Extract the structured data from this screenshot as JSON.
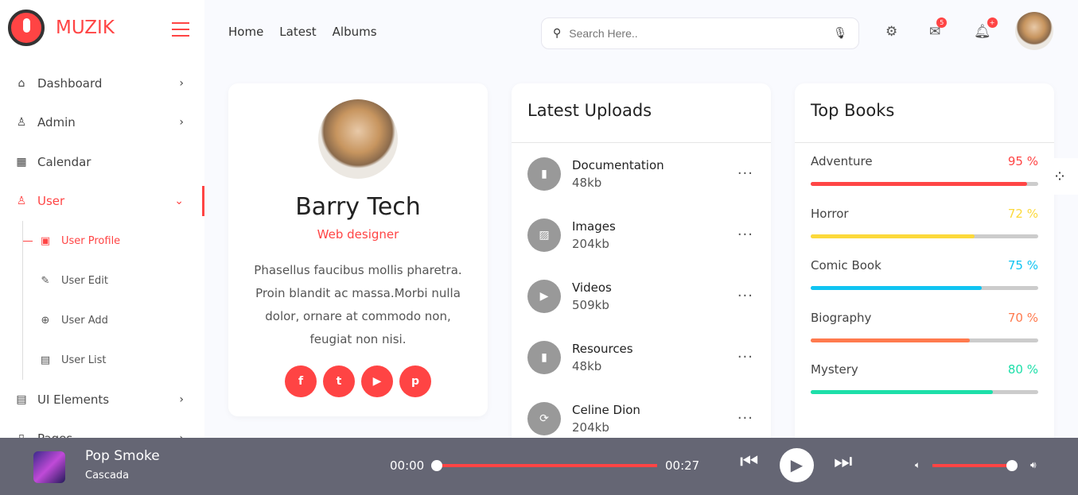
{
  "brand": {
    "name": "MUZIK"
  },
  "sidebar": {
    "items": [
      {
        "label": "Dashboard",
        "icon": "home-icon"
      },
      {
        "label": "Admin",
        "icon": "user-lock-icon"
      },
      {
        "label": "Calendar",
        "icon": "calendar-icon"
      },
      {
        "label": "User",
        "icon": "user-icon",
        "active": true
      },
      {
        "label": "UI Elements",
        "icon": "list-icon"
      },
      {
        "label": "Pages",
        "icon": "file-icon"
      }
    ],
    "sub_items": [
      {
        "label": "User Profile",
        "active": true
      },
      {
        "label": "User Edit"
      },
      {
        "label": "User Add"
      },
      {
        "label": "User List"
      }
    ]
  },
  "topnav": {
    "links": [
      "Home",
      "Latest",
      "Albums"
    ]
  },
  "search": {
    "placeholder": "Search Here..",
    "value": ""
  },
  "header": {
    "mail_badge": "5",
    "notif_badge": "+"
  },
  "profile": {
    "name": "Barry Tech",
    "role": "Web designer",
    "description": "Phasellus faucibus mollis pharetra. Proin blandit ac massa.Morbi nulla dolor, ornare at commodo non, feugiat non nisi.",
    "social": [
      "f",
      "t",
      "▶",
      "p"
    ]
  },
  "uploads": {
    "title": "Latest Uploads",
    "items": [
      {
        "name": "Documentation",
        "size": "48kb",
        "icon": "file-icon"
      },
      {
        "name": "Images",
        "size": "204kb",
        "icon": "image-icon"
      },
      {
        "name": "Videos",
        "size": "509kb",
        "icon": "video-icon"
      },
      {
        "name": "Resources",
        "size": "48kb",
        "icon": "file-icon"
      },
      {
        "name": "Celine Dion",
        "size": "204kb",
        "icon": "sync-icon"
      }
    ]
  },
  "books": {
    "title": "Top Books",
    "items": [
      {
        "name": "Adventure",
        "percent": 95,
        "label": "95 %",
        "color": "#ff4545"
      },
      {
        "name": "Horror",
        "percent": 72,
        "label": "72 %",
        "color": "#fcd93a"
      },
      {
        "name": "Comic Book",
        "percent": 75,
        "label": "75 %",
        "color": "#10c4f2"
      },
      {
        "name": "Biography",
        "percent": 70,
        "label": "70 %",
        "color": "#ff7a4e"
      },
      {
        "name": "Mystery",
        "percent": 80,
        "label": "80 %",
        "color": "#1ddfa9"
      }
    ]
  },
  "player": {
    "song": "Pop Smoke",
    "artist": "Cascada",
    "current": "00:00",
    "duration": "00:27",
    "progress": 0,
    "volume": 0.95
  }
}
